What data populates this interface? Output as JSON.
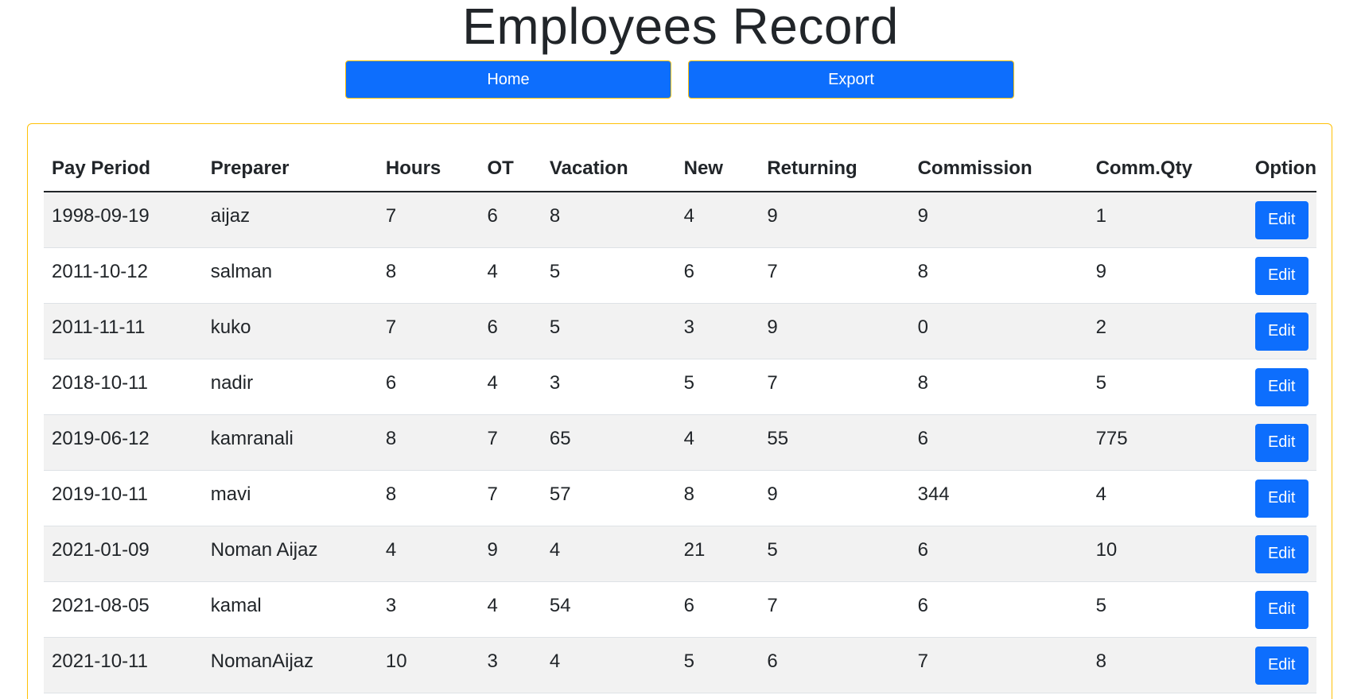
{
  "page": {
    "title": "Employees Record"
  },
  "toolbar": {
    "home_label": "Home",
    "export_label": "Export"
  },
  "colors": {
    "primary": "#0d6efd",
    "border_accent": "#ffc107",
    "stripe": "#f2f2f2"
  },
  "table": {
    "headers": [
      "Pay Period",
      "Preparer",
      "Hours",
      "OT",
      "Vacation",
      "New",
      "Returning",
      "Commission",
      "Comm.Qty",
      "Option"
    ],
    "rows": [
      {
        "pay_period": "1998-09-19",
        "preparer": "aijaz",
        "hours": "7",
        "ot": "6",
        "vacation": "8",
        "new": "4",
        "returning": "9",
        "commission": "9",
        "comm_qty": "1",
        "option": "Edit"
      },
      {
        "pay_period": "2011-10-12",
        "preparer": "salman",
        "hours": "8",
        "ot": "4",
        "vacation": "5",
        "new": "6",
        "returning": "7",
        "commission": "8",
        "comm_qty": "9",
        "option": "Edit"
      },
      {
        "pay_period": "2011-11-11",
        "preparer": "kuko",
        "hours": "7",
        "ot": "6",
        "vacation": "5",
        "new": "3",
        "returning": "9",
        "commission": "0",
        "comm_qty": "2",
        "option": "Edit"
      },
      {
        "pay_period": "2018-10-11",
        "preparer": "nadir",
        "hours": "6",
        "ot": "4",
        "vacation": "3",
        "new": "5",
        "returning": "7",
        "commission": "8",
        "comm_qty": "5",
        "option": "Edit"
      },
      {
        "pay_period": "2019-06-12",
        "preparer": "kamranali",
        "hours": "8",
        "ot": "7",
        "vacation": "65",
        "new": "4",
        "returning": "55",
        "commission": "6",
        "comm_qty": "775",
        "option": "Edit"
      },
      {
        "pay_period": "2019-10-11",
        "preparer": "mavi",
        "hours": "8",
        "ot": "7",
        "vacation": "57",
        "new": "8",
        "returning": "9",
        "commission": "344",
        "comm_qty": "4",
        "option": "Edit"
      },
      {
        "pay_period": "2021-01-09",
        "preparer": "Noman Aijaz",
        "hours": "4",
        "ot": "9",
        "vacation": "4",
        "new": "21",
        "returning": "5",
        "commission": "6",
        "comm_qty": "10",
        "option": "Edit"
      },
      {
        "pay_period": "2021-08-05",
        "preparer": "kamal",
        "hours": "3",
        "ot": "4",
        "vacation": "54",
        "new": "6",
        "returning": "7",
        "commission": "6",
        "comm_qty": "5",
        "option": "Edit"
      },
      {
        "pay_period": "2021-10-11",
        "preparer": "NomanAijaz",
        "hours": "10",
        "ot": "3",
        "vacation": "4",
        "new": "5",
        "returning": "6",
        "commission": "7",
        "comm_qty": "8",
        "option": "Edit"
      }
    ]
  }
}
